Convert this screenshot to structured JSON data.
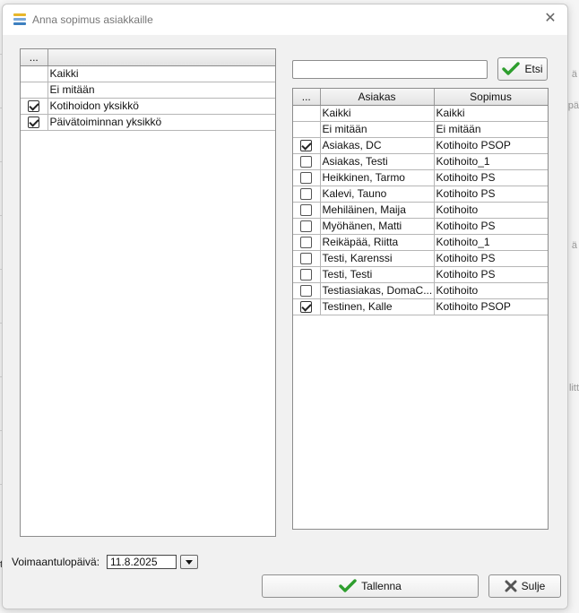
{
  "background": {
    "fragments": [
      "ä",
      "pä",
      "ä",
      "litt",
      "t"
    ]
  },
  "dialog": {
    "title": "Anna sopimus asiakkaille",
    "close_glyph": "✕"
  },
  "left_grid": {
    "header": "...",
    "rows": [
      {
        "label": "Kaikki",
        "checked": null
      },
      {
        "label": "Ei mitään",
        "checked": null
      },
      {
        "label": "Kotihoidon yksikkö",
        "checked": true
      },
      {
        "label": "Päivätoiminnan yksikkö",
        "checked": true
      }
    ]
  },
  "search": {
    "value": "",
    "button_label": "Etsi",
    "button_icon": "check-icon"
  },
  "right_grid": {
    "headers": [
      "...",
      "Asiakas",
      "Sopimus"
    ],
    "rows": [
      {
        "asiakas": "Kaikki",
        "sopimus": "Kaikki",
        "checked": null
      },
      {
        "asiakas": "Ei mitään",
        "sopimus": "Ei mitään",
        "checked": null
      },
      {
        "asiakas": "Asiakas, DC",
        "sopimus": "Kotihoito PSOP",
        "checked": true
      },
      {
        "asiakas": "Asiakas, Testi",
        "sopimus": "Kotihoito_1",
        "checked": false
      },
      {
        "asiakas": "Heikkinen, Tarmo",
        "sopimus": "Kotihoito PS",
        "checked": false
      },
      {
        "asiakas": "Kalevi, Tauno",
        "sopimus": "Kotihoito PS",
        "checked": false
      },
      {
        "asiakas": "Mehiläinen, Maija",
        "sopimus": "Kotihoito",
        "checked": false
      },
      {
        "asiakas": "Myöhänen, Matti",
        "sopimus": "Kotihoito PS",
        "checked": false
      },
      {
        "asiakas": "Reikäpää, Riitta",
        "sopimus": "Kotihoito_1",
        "checked": false
      },
      {
        "asiakas": "Testi, Karenssi",
        "sopimus": "Kotihoito PS",
        "checked": false
      },
      {
        "asiakas": "Testi, Testi",
        "sopimus": "Kotihoito PS",
        "checked": false
      },
      {
        "asiakas": "Testiasiakas, DomaC...",
        "sopimus": "Kotihoito",
        "checked": false
      },
      {
        "asiakas": "Testinen, Kalle",
        "sopimus": "Kotihoito PSOP",
        "checked": true
      }
    ]
  },
  "effective_date": {
    "label": "Voimaantulopäivä:",
    "value": "11.8.2025"
  },
  "footer": {
    "save_label": "Tallenna",
    "close_label": "Sulje"
  },
  "colors": {
    "check_green": "#2e9e2e",
    "close_x_gray": "#555555",
    "icon_stripes": [
      "#e8b62a",
      "#7aa7d8",
      "#3d7fbf"
    ]
  }
}
